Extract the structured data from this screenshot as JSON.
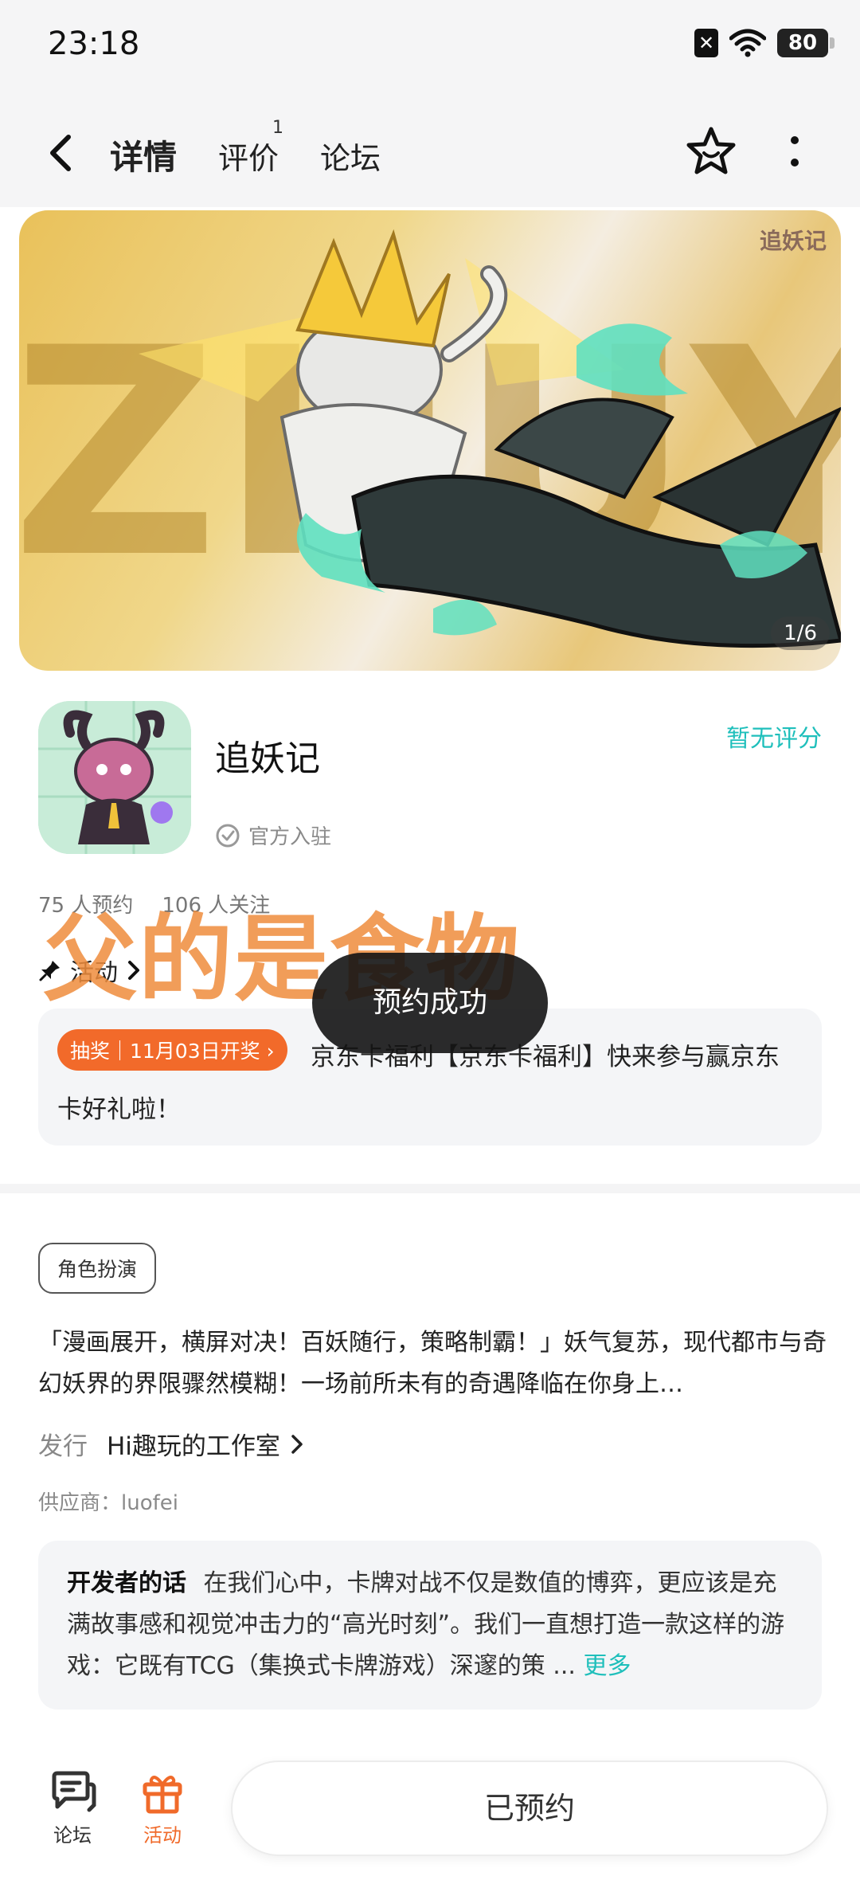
{
  "status_bar": {
    "time": "23:18",
    "battery": "80"
  },
  "nav": {
    "tabs": [
      {
        "label": "详情"
      },
      {
        "label": "评价"
      },
      {
        "label": "论坛"
      }
    ],
    "review_badge": "1"
  },
  "banner": {
    "counter": "1/6",
    "watermark": "ZHUYAOJI",
    "corner_logo": "追妖记"
  },
  "app": {
    "name": "追妖记",
    "official_label": "官方入驻",
    "rating": "暂无评分",
    "reservations": "75 人预约",
    "followers": "106 人关注"
  },
  "activity": {
    "header": "活动",
    "tag": "抽奖｜11月03日开奖",
    "text": "京东卡福利【京东卡福利】快来参与赢京东卡好礼啦！"
  },
  "toast": "预约成功",
  "overlay_text": "父的是食物",
  "details": {
    "genre_tag": "角色扮演",
    "description": "「漫画展开，横屏对决！百妖随行，策略制霸！」妖气复苏，现代都市与奇幻妖界的界限骤然模糊！一场前所未有的奇遇降临在你身上…",
    "publisher_label": "发行",
    "publisher": "Hi趣玩的工作室",
    "supplier": "供应商：luofei"
  },
  "developer_note": {
    "title": "开发者的话",
    "text": "在我们心中，卡牌对战不仅是数值的博弈，更应该是充满故事感和视觉冲击力的“高光时刻”。我们一直想打造一款这样的游戏：它既有TCG（集换式卡牌游戏）深邃的策 ...",
    "more": "更多"
  },
  "bottom_bar": {
    "forum_label": "论坛",
    "activity_label": "活动",
    "reserve_button": "已预约"
  },
  "colors": {
    "accent": "#1fbfbb",
    "tab_underline": "#2bd0c9",
    "orange": "#f26a2a"
  }
}
